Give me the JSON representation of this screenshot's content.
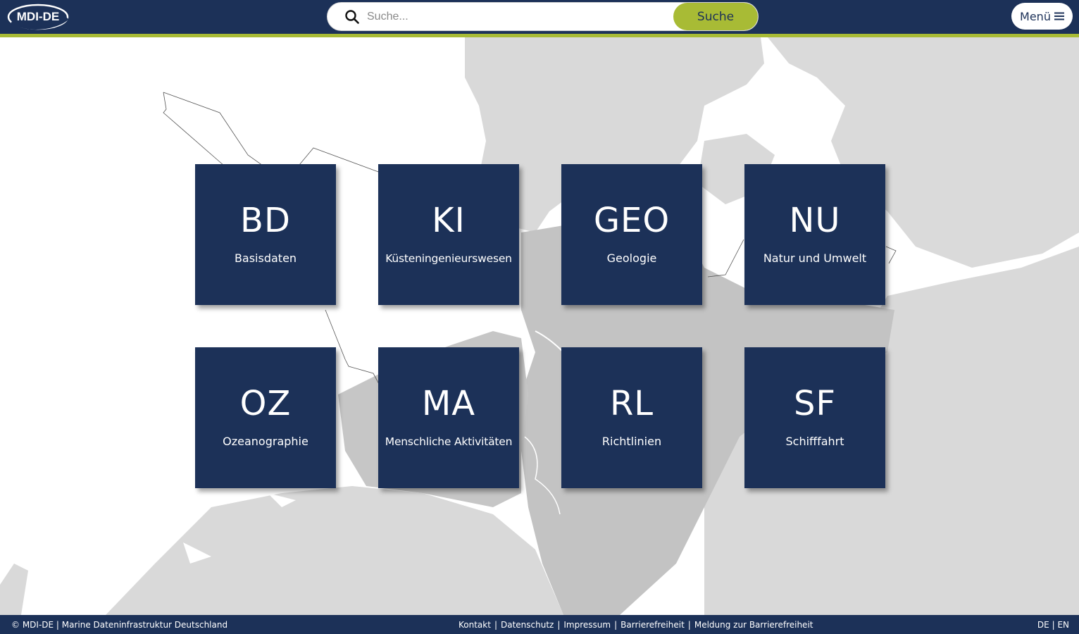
{
  "header": {
    "logo_text": "MDI-DE",
    "search_placeholder": "Suche...",
    "search_button_label": "Suche",
    "menu_label": "Menü"
  },
  "tiles": [
    {
      "abbr": "BD",
      "name": "Basisdaten"
    },
    {
      "abbr": "KI",
      "name": "Küsteningenieurswesen"
    },
    {
      "abbr": "GEO",
      "name": "Geologie"
    },
    {
      "abbr": "NU",
      "name": "Natur und Umwelt"
    },
    {
      "abbr": "OZ",
      "name": "Ozeanographie"
    },
    {
      "abbr": "MA",
      "name": "Menschliche Aktivitäten"
    },
    {
      "abbr": "RL",
      "name": "Richtlinien"
    },
    {
      "abbr": "SF",
      "name": "Schifffahrt"
    }
  ],
  "footer": {
    "copyright": "© MDI-DE | Marine Dateninfrastruktur Deutschland",
    "links": [
      "Kontakt",
      "Datenschutz",
      "Impressum",
      "Barrierefreiheit",
      "Meldung zur Barrierefreiheit"
    ],
    "separator": "|",
    "lang_de": "DE",
    "lang_en": "EN"
  },
  "colors": {
    "navy": "#1c3158",
    "accent_green": "#a8bb35",
    "land_light": "#d9d9d9",
    "land_dark": "#c0c0c0",
    "sea": "#ffffff"
  },
  "icons": [
    "mdi-de-logo",
    "search-icon",
    "hamburger-menu-icon"
  ]
}
